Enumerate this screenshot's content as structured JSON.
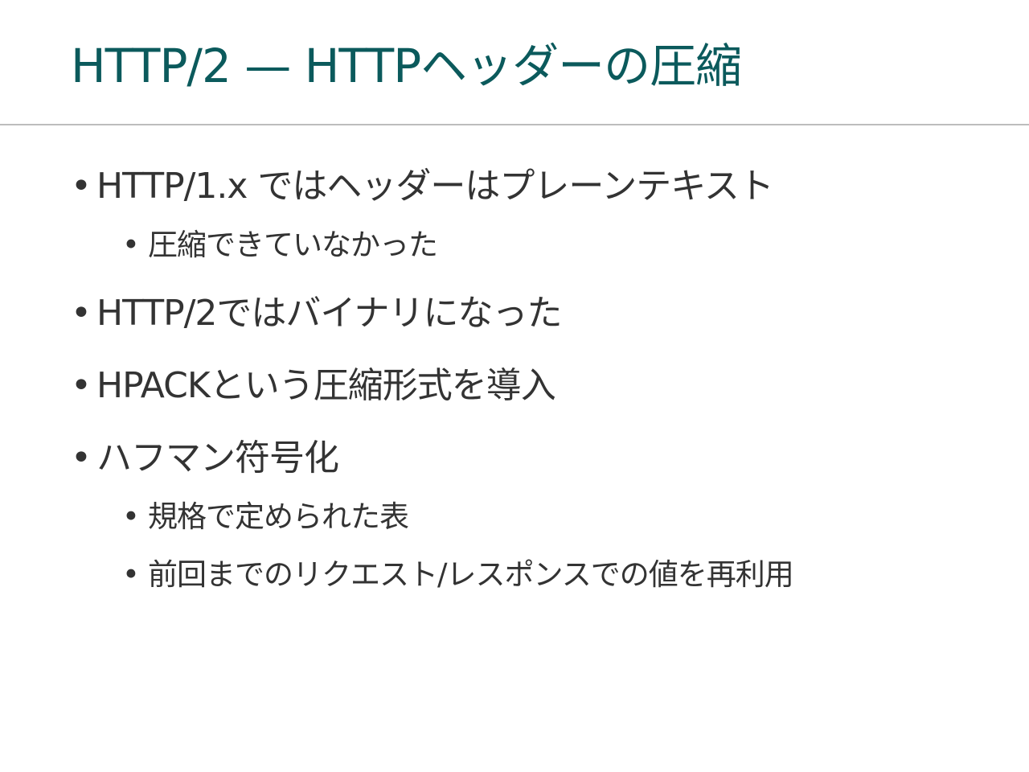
{
  "slide": {
    "title": "HTTP/2 — HTTPヘッダーの圧縮",
    "bullets": [
      {
        "text": "HTTP/1.x ではヘッダーはプレーンテキスト",
        "level": 1
      },
      {
        "text": "圧縮できていなかった",
        "level": 2
      },
      {
        "text": "HTTP/2ではバイナリになった",
        "level": 1
      },
      {
        "text": "HPACKという圧縮形式を導入",
        "level": 1
      },
      {
        "text": "ハフマン符号化",
        "level": 1
      },
      {
        "text": "規格で定められた表",
        "level": 2
      },
      {
        "text": "前回までのリクエスト/レスポンスでの値を再利用",
        "level": 2
      }
    ],
    "bullet_glyph": "•",
    "colors": {
      "title": "#0b5a5c",
      "text": "#333333",
      "divider": "#bdbdbd",
      "background": "#ffffff"
    }
  }
}
